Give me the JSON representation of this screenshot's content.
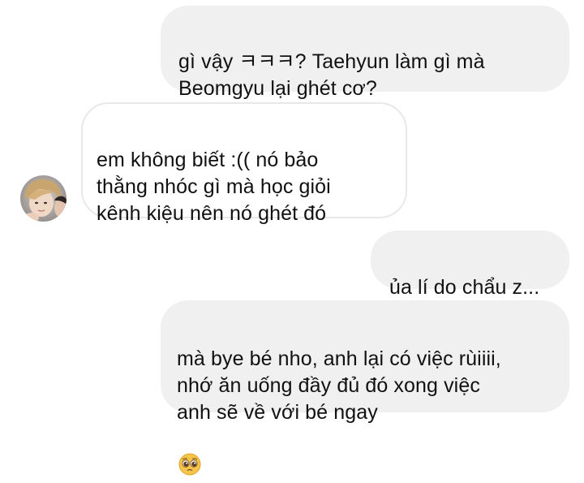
{
  "conversation": {
    "messages": [
      {
        "sender": "self",
        "text": "gì vậy ㅋㅋㅋ? Taehyun làm gì mà\nBeomgyu lại ghét cơ?"
      },
      {
        "sender": "other",
        "text": "em không biết :(( nó bảo\nthằng nhóc gì mà học giỏi\nkênh kiệu nên nó ghét đó"
      },
      {
        "sender": "self",
        "text": "ủa lí do chẩu z..."
      },
      {
        "sender": "self",
        "text": "mà bye bé nho, anh lại có việc rùiiii,\nnhớ ăn uống đầy đủ đó xong việc\nanh sẽ về với bé ngay",
        "emoji": "pleading-face-emoji"
      }
    ]
  },
  "colors": {
    "sent_bubble": "#f0f0f0",
    "received_border": "#e8e8e8",
    "text": "#111111"
  }
}
